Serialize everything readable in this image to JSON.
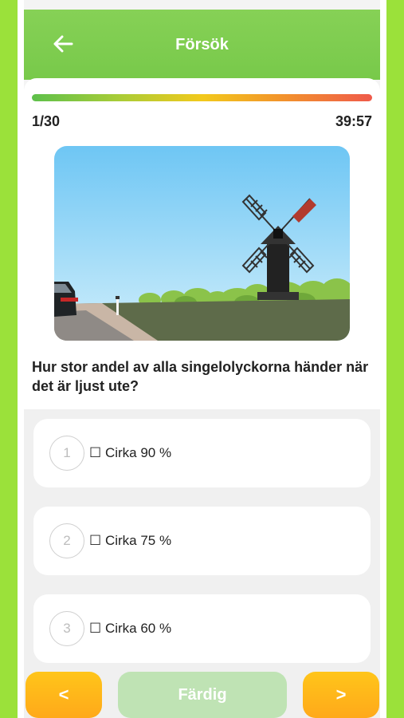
{
  "header": {
    "title": "Försök",
    "back_icon": "arrow-left-icon"
  },
  "progress": {
    "fraction": 1.0,
    "gradient": [
      "#5ec04b",
      "#a7cc38",
      "#f2c91c",
      "#f2962a",
      "#ef5a4a"
    ]
  },
  "status": {
    "question_counter": "1/30",
    "timer": "39:57"
  },
  "question": {
    "text": "Hur stor andel av alla singelolyckorna händer när det är ljust ute?"
  },
  "options": [
    {
      "number": "1",
      "label": "☐ Cirka 90 %"
    },
    {
      "number": "2",
      "label": "☐ Cirka 75 %"
    },
    {
      "number": "3",
      "label": "☐ Cirka 60 %"
    }
  ],
  "footer": {
    "prev_label": "<",
    "finish_label": "Färdig",
    "next_label": ">"
  },
  "colors": {
    "accent_green": "#78c94a",
    "nav_yellow": "#ffb31a",
    "finish_disabled": "#bfe3b4",
    "outer_bg": "#9be13a"
  }
}
